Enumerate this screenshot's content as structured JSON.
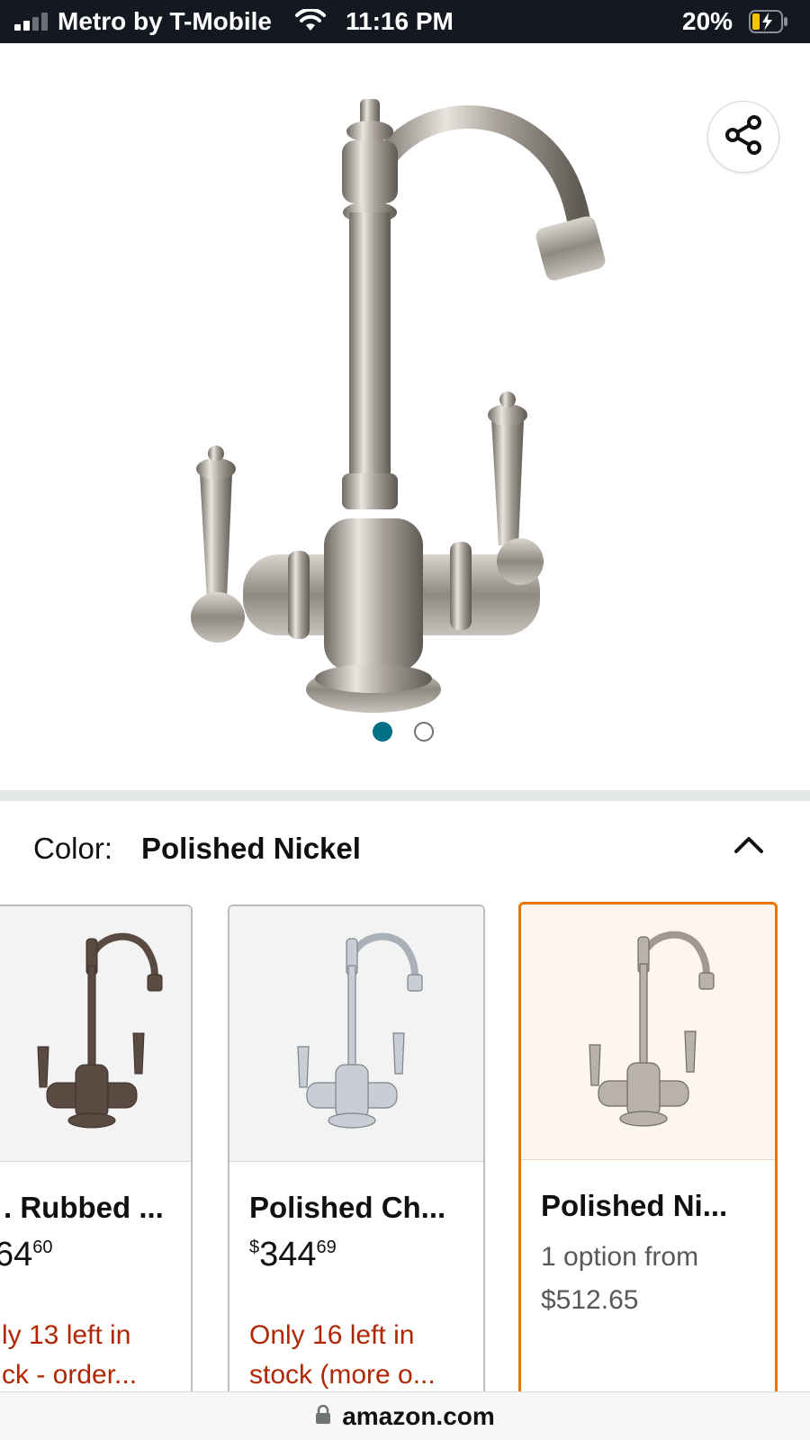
{
  "status_bar": {
    "carrier": "Metro by T-Mobile",
    "time": "11:16 PM",
    "battery": "20%"
  },
  "gallery": {
    "share_icon": "share-icon",
    "image_count": 2,
    "active_index": 0
  },
  "variation": {
    "label": "Color:",
    "selected": "Polished Nickel",
    "toggle_icon": "chevron-up-icon"
  },
  "swatches": [
    {
      "name": "Oil Rubbed ...",
      "visible_name": ". Rubbed ...",
      "price_whole": "64",
      "price_fraction": "60",
      "stock_line1": "ly 13 left in",
      "stock_line2": "ck - order...",
      "finish_color": "#5a4a42",
      "selected": false
    },
    {
      "name": "Polished Ch...",
      "price_symbol": "$",
      "price_whole": "344",
      "price_fraction": "69",
      "stock_line1": "Only 16 left in",
      "stock_line2": "stock (more o...",
      "finish_color": "#c9ced4",
      "selected": false
    },
    {
      "name": "Polished Ni...",
      "option_line1": "1 option from",
      "option_line2": "$512.65",
      "finish_color": "#b8b2a8",
      "selected": true
    }
  ],
  "url_bar": {
    "domain": "amazon.com",
    "lock_icon": "lock-icon"
  },
  "colors": {
    "accent_teal": "#007185",
    "selected_border": "#e77600",
    "stock_red": "#b12704"
  }
}
